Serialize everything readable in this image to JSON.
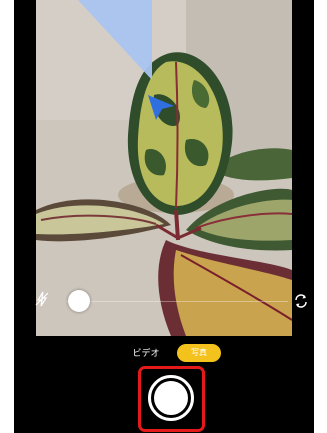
{
  "camera": {
    "modes": {
      "video_label": "ビデオ",
      "photo_label": "写真",
      "selected": "photo"
    },
    "colors": {
      "selected_mode_bg": "#f4c21c",
      "highlight_box": "#e41a1a",
      "pointer_callout": "#a9c4f0",
      "pointer_arrow": "#2f6fe0"
    },
    "icons": {
      "flash": "flash-off-icon",
      "flip": "camera-flip-icon",
      "pointer": "cursor-arrow-icon"
    },
    "zoom_position": 0.05
  }
}
